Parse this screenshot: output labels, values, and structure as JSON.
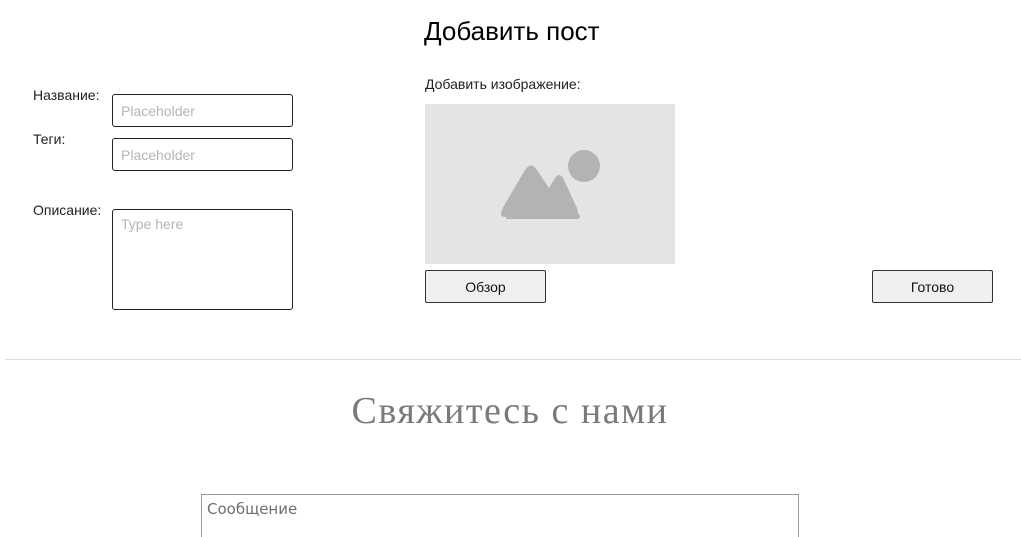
{
  "add_post": {
    "title": "Добавить пост",
    "name_label": "Название:",
    "name_placeholder": "Placeholder",
    "tags_label": "Теги:",
    "tags_placeholder": "Placeholder",
    "description_label": "Описание:",
    "description_placeholder": "Type here",
    "image_label": "Добавить изображение:",
    "image_icon": "image-placeholder-icon",
    "browse_button": "Обзор",
    "done_button": "Готово"
  },
  "contact": {
    "title": "Свяжитесь с нами",
    "message_placeholder": "Сообщение"
  },
  "colors": {
    "image_bg": "#e4e4e4",
    "image_icon": "#b3b3b3",
    "contact_title": "#7a7a7a"
  }
}
